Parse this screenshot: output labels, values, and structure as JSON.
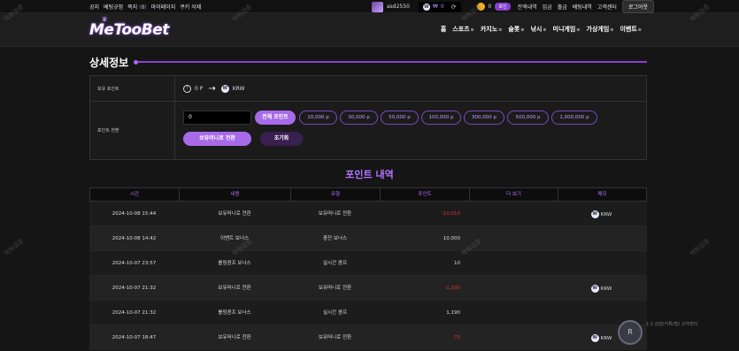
{
  "topbar": {
    "links": [
      "공지",
      "베팅규정",
      "쪽지",
      "0",
      "마이페이지",
      "쿠키 삭제"
    ],
    "username": "asd2550",
    "wallet_value": "0",
    "coin_value": "0",
    "coin_badge": "포인",
    "menu": [
      "잔액내역",
      "입금",
      "출금",
      "베팅내역",
      "고객센터"
    ],
    "logout": "로그아웃"
  },
  "header": {
    "logo": "MeTooBet",
    "nav": [
      "홈",
      "스포츠",
      "카지노",
      "슬롯",
      "낚시",
      "미니게임",
      "가상게임",
      "이벤트"
    ]
  },
  "page": {
    "title": "상세정보",
    "points_label": "보유 포인트",
    "points_value": "0 P",
    "krw_label": "KRW",
    "convert_label": "포인트 전환",
    "input_value": "0",
    "all_points": "전체 포인트",
    "amounts": [
      "10,000 p",
      "30,000 p",
      "50,000 p",
      "100,000 p",
      "300,000 p",
      "500,000 p",
      "1,000,000 p"
    ],
    "convert_btn": "보유머니로 전환",
    "reset_btn": "초기화"
  },
  "history": {
    "title": "포인트 내역",
    "columns": [
      "시간",
      "내용",
      "유형",
      "포인트",
      "더 보기",
      "메모"
    ],
    "rows": [
      {
        "time": "2024-10-08 15:44",
        "content": "보유머니로 전환",
        "type": "보유머니로 전환",
        "points": "-10,010",
        "neg": true,
        "memo": "KRW"
      },
      {
        "time": "2024-10-08 14:42",
        "content": "이벤트 보너스",
        "type": "충전 보너스",
        "points": "10,000",
        "neg": false,
        "memo": ""
      },
      {
        "time": "2024-10-07 23:57",
        "content": "롤링콤프 보너스",
        "type": "실시간 콤프",
        "points": "10",
        "neg": false,
        "memo": ""
      },
      {
        "time": "2024-10-07 21:32",
        "content": "보유머니로 전환",
        "type": "보유머니로 전환",
        "points": "-1,190",
        "neg": true,
        "memo": "KRW"
      },
      {
        "time": "2024-10-07 21:32",
        "content": "롤링콤프 보너스",
        "type": "실시간 콤프",
        "points": "1,190",
        "neg": false,
        "memo": ""
      },
      {
        "time": "2024-10-07 18:47",
        "content": "보유머니로 전환",
        "type": "보유머니로 전환",
        "points": "-70",
        "neg": true,
        "memo": "KRW"
      }
    ]
  },
  "watermark": "먹튀검증",
  "cs": {
    "icon": "R",
    "text": "1:1 상담(카톡/텔) 고객센터"
  }
}
